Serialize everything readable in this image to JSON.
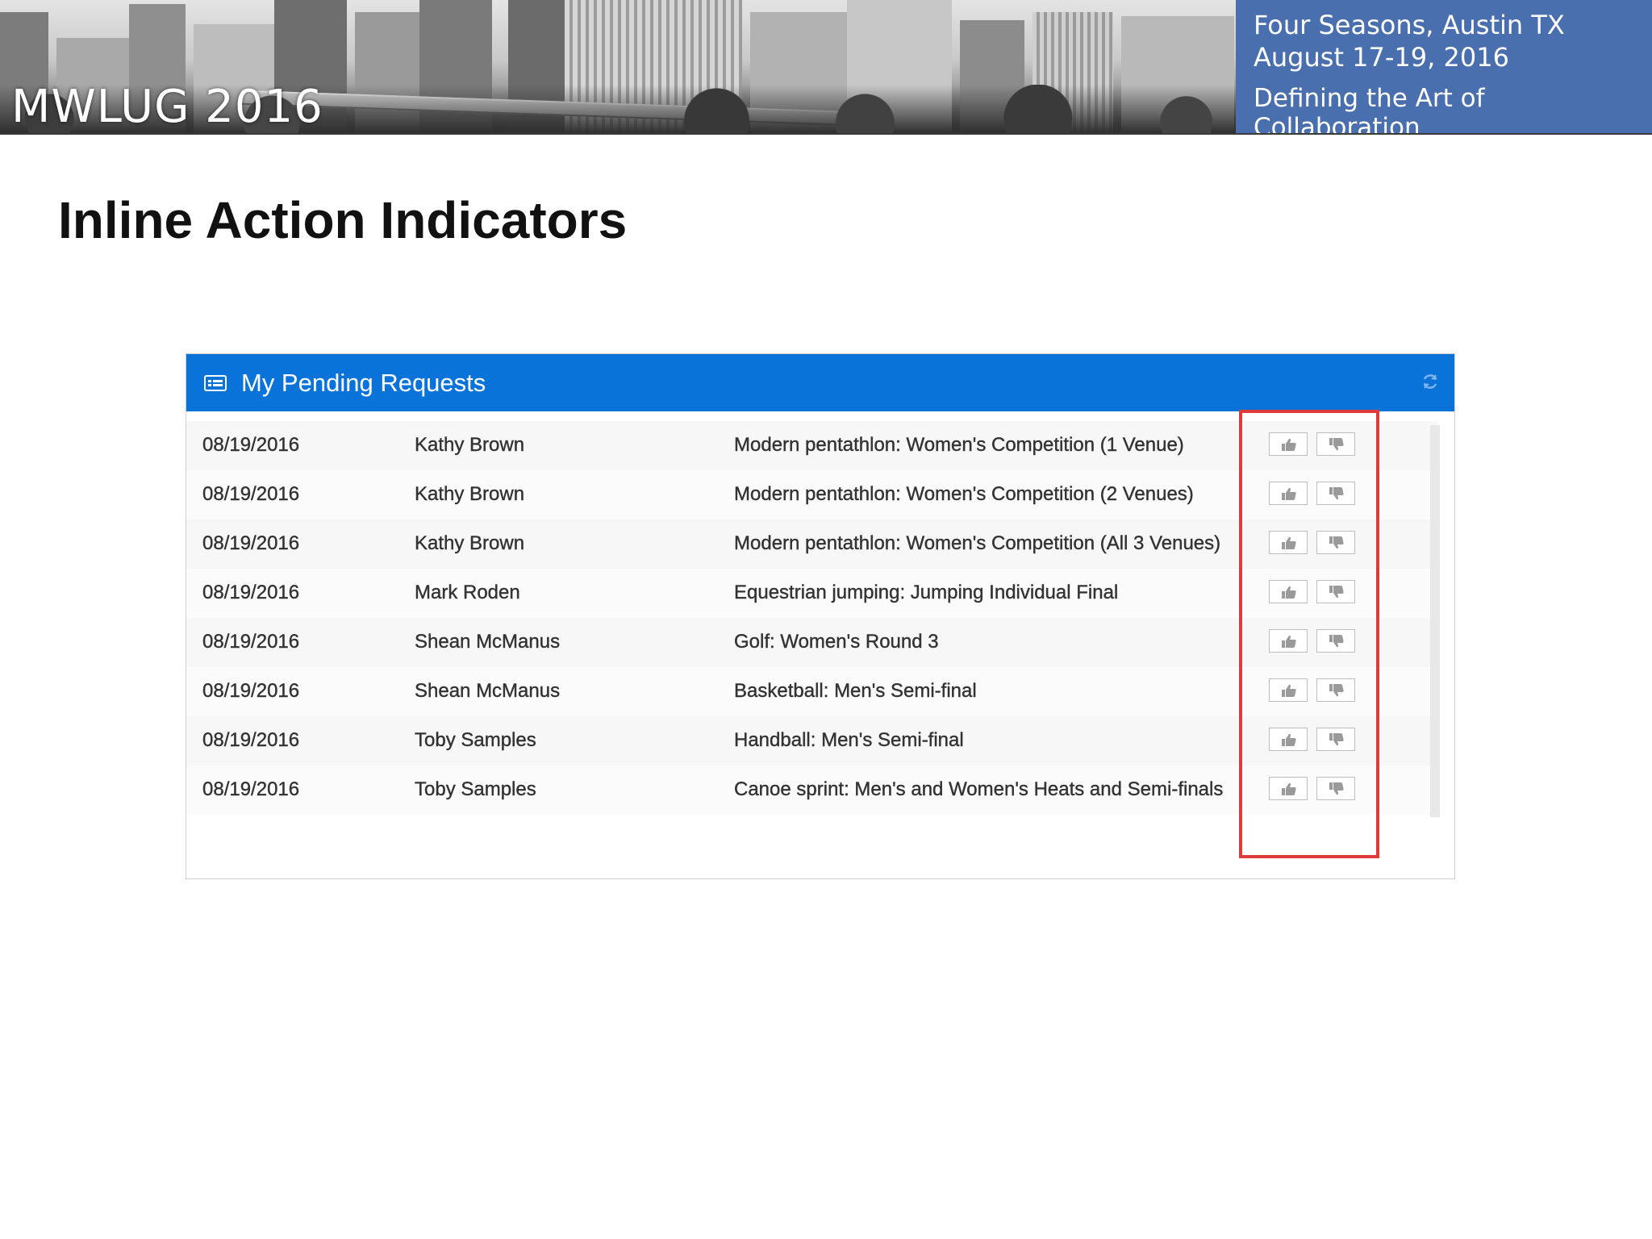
{
  "banner": {
    "logo": "MWLUG 2016",
    "venue": "Four Seasons, Austin TX",
    "dates": "August 17-19, 2016",
    "tagline": "Defining the Art of Collaboration"
  },
  "slide": {
    "title": "Inline Action Indicators"
  },
  "panel": {
    "title": "My Pending Requests",
    "header_icon": "list-icon",
    "refresh_icon": "refresh-icon"
  },
  "requests": [
    {
      "date": "08/19/2016",
      "name": "Kathy Brown",
      "event": "Modern pentathlon: Women's Competition (1 Venue)"
    },
    {
      "date": "08/19/2016",
      "name": "Kathy Brown",
      "event": "Modern pentathlon: Women's Competition (2 Venues)"
    },
    {
      "date": "08/19/2016",
      "name": "Kathy Brown",
      "event": "Modern pentathlon: Women's Competition (All 3 Venues)"
    },
    {
      "date": "08/19/2016",
      "name": "Mark Roden",
      "event": "Equestrian jumping: Jumping Individual Final"
    },
    {
      "date": "08/19/2016",
      "name": "Shean McManus",
      "event": "Golf: Women's Round 3"
    },
    {
      "date": "08/19/2016",
      "name": "Shean McManus",
      "event": "Basketball: Men's Semi-final"
    },
    {
      "date": "08/19/2016",
      "name": "Toby Samples",
      "event": "Handball: Men's Semi-final"
    },
    {
      "date": "08/19/2016",
      "name": "Toby Samples",
      "event": "Canoe sprint: Men's and Women's Heats and Semi-finals"
    }
  ],
  "actions": {
    "approve_icon": "thumbs-up-icon",
    "reject_icon": "thumbs-down-icon"
  },
  "colors": {
    "header": "#0a73d9",
    "highlight": "#e03b3b",
    "banner_info": "#4a6fae"
  }
}
